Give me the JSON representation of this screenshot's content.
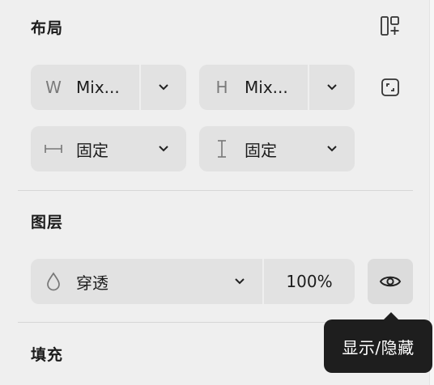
{
  "layout": {
    "title": "布局",
    "width": {
      "prefix": "W",
      "value": "Mix..."
    },
    "height": {
      "prefix": "H",
      "value": "Mix..."
    },
    "horizontal_sizing": {
      "value": "固定"
    },
    "vertical_sizing": {
      "value": "固定"
    }
  },
  "layer": {
    "title": "图层",
    "blend_mode": "穿透",
    "opacity": "100%"
  },
  "fill": {
    "title": "填充"
  },
  "tooltip": {
    "text": "显示/隐藏"
  },
  "icons": {
    "auto_layout": "add-auto-layout-icon",
    "resize_to_fit": "resize-to-fit-icon",
    "drop": "drop-icon",
    "eye": "eye-icon",
    "chevron": "chevron-down-icon"
  }
}
